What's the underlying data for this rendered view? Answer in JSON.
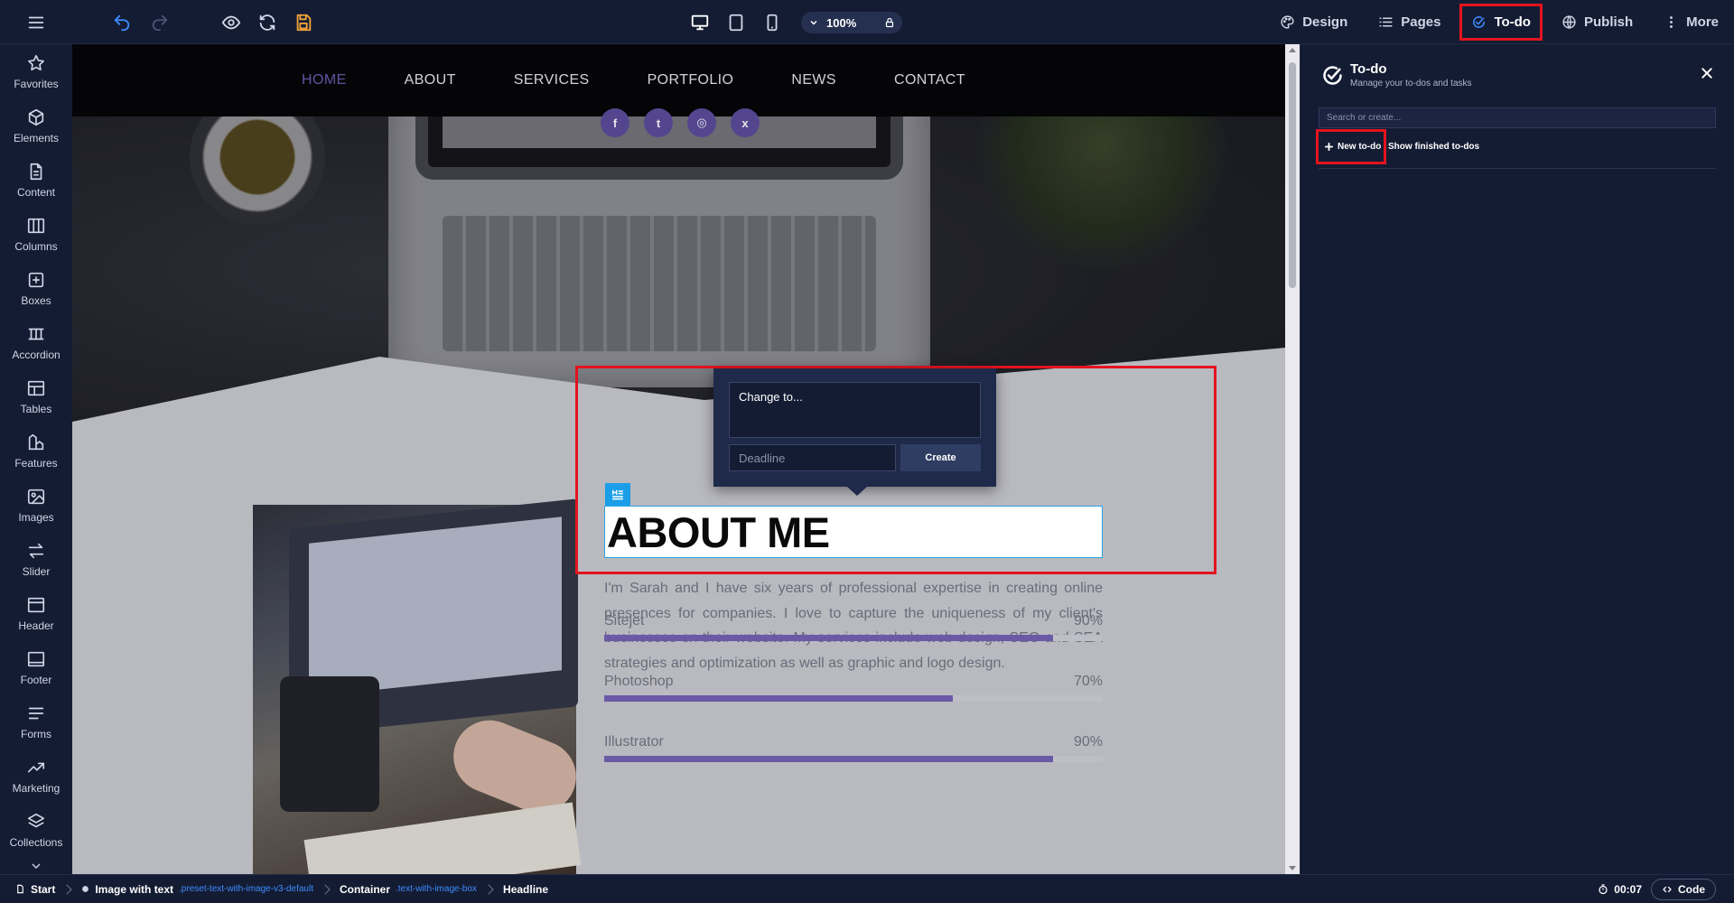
{
  "toolbar": {
    "zoom": "100%",
    "nav": [
      {
        "label": "Design",
        "icon": "palette-icon"
      },
      {
        "label": "Pages",
        "icon": "list-icon"
      },
      {
        "label": "To-do",
        "icon": "check-circle-icon",
        "active": true
      },
      {
        "label": "Publish",
        "icon": "globe-icon"
      },
      {
        "label": "More",
        "icon": "dots-vertical-icon"
      }
    ],
    "icons": [
      "menu-icon",
      "undo-icon",
      "redo-icon",
      "preview-eye-icon",
      "refresh-icon",
      "save-icon",
      "desktop-icon",
      "tablet-icon",
      "mobile-icon",
      "chevron-down-icon",
      "lock-icon"
    ],
    "save_color": "#f2a33a",
    "undo_color": "#3d8bff"
  },
  "sidebar": {
    "items": [
      {
        "label": "Favorites",
        "icon": "star-icon"
      },
      {
        "label": "Elements",
        "icon": "cube-icon"
      },
      {
        "label": "Content",
        "icon": "document-icon"
      },
      {
        "label": "Columns",
        "icon": "columns-icon"
      },
      {
        "label": "Boxes",
        "icon": "box-plus-icon"
      },
      {
        "label": "Accordion",
        "icon": "accordion-icon"
      },
      {
        "label": "Tables",
        "icon": "table-icon"
      },
      {
        "label": "Features",
        "icon": "features-icon"
      },
      {
        "label": "Images",
        "icon": "image-icon"
      },
      {
        "label": "Slider",
        "icon": "slider-arrows-icon"
      },
      {
        "label": "Header",
        "icon": "header-icon"
      },
      {
        "label": "Footer",
        "icon": "footer-icon"
      },
      {
        "label": "Forms",
        "icon": "forms-icon"
      },
      {
        "label": "Marketing",
        "icon": "trending-icon"
      },
      {
        "label": "Collections",
        "icon": "layers-icon"
      }
    ]
  },
  "site": {
    "nav": [
      "HOME",
      "ABOUT",
      "SERVICES",
      "PORTFOLIO",
      "NEWS",
      "CONTACT"
    ],
    "nav_active": "HOME",
    "socials": [
      {
        "icon": "facebook-icon",
        "glyph": "f"
      },
      {
        "icon": "twitter-icon",
        "glyph": "t"
      },
      {
        "icon": "instagram-icon",
        "glyph": "◎"
      },
      {
        "icon": "xing-icon",
        "glyph": "x"
      }
    ],
    "headline": "ABOUT ME",
    "about_text": "I'm Sarah and I have six years of professional expertise in creating online presences for companies. I love to capture the uniqueness of my client's businesses on their website. My services include web design, SEO and SEA strategies and optimization as well as graphic and logo design.",
    "skills": [
      {
        "name": "Sitejet",
        "value": "90%",
        "fraction": 0.9
      },
      {
        "name": "Photoshop",
        "value": "70%",
        "fraction": 0.7
      },
      {
        "name": "Illustrator",
        "value": "90%",
        "fraction": 0.9
      }
    ],
    "accent": "#6a5aa6"
  },
  "todo_popup": {
    "textarea_value": "Change to...",
    "deadline_placeholder": "Deadline",
    "create_label": "Create"
  },
  "panel": {
    "title": "To-do",
    "subtitle": "Manage your to-dos and tasks",
    "search_placeholder": "Search or create...",
    "new_todo_label": "New to-do",
    "show_finished_label": "Show finished to-dos"
  },
  "statusbar": {
    "breadcrumbs": [
      {
        "label": "Start",
        "class_name": ""
      },
      {
        "label": "Image with text",
        "class_name": ".preset-text-with-image-v3-default"
      },
      {
        "label": "Container",
        "class_name": ".text-with-image-box"
      },
      {
        "label": "Headline",
        "class_name": ""
      }
    ],
    "timer": "00:07",
    "code_label": "Code"
  },
  "highlight_color": "#e3141e"
}
